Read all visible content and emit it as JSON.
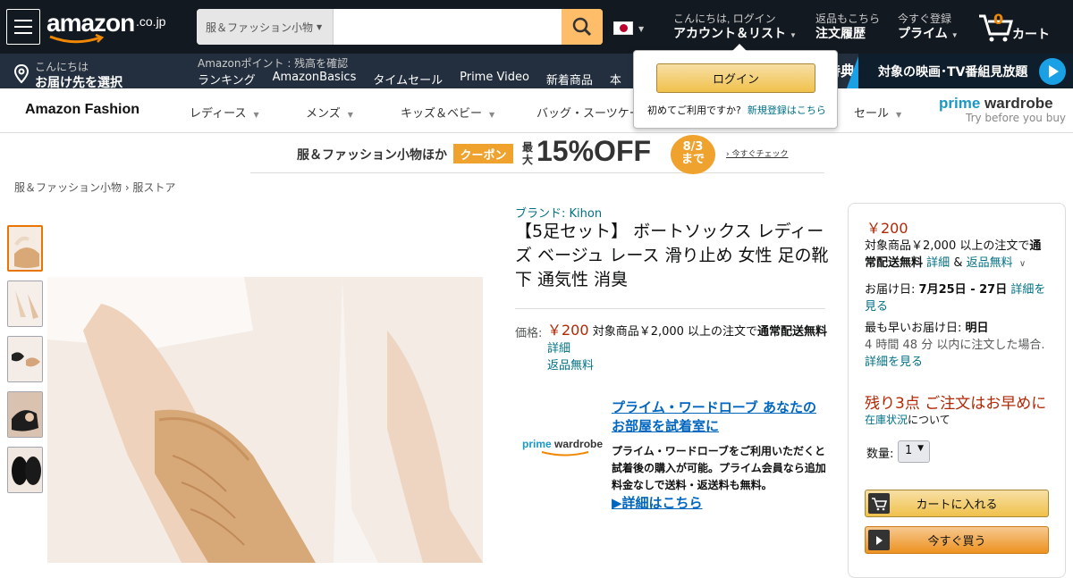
{
  "nav": {
    "logo_text": "amazon",
    "logo_suffix": ".co.jp",
    "search_category": "服＆ファッション小物",
    "search_value": "",
    "account_line1": "こんにちは, ログイン",
    "account_line2": "アカウント＆リスト",
    "orders_line1": "返品もこちら",
    "orders_line2": "注文履歴",
    "prime_line1": "今すぐ登録",
    "prime_line2": "プライム",
    "cart_count": "0",
    "cart_label": "カート"
  },
  "subnav": {
    "deliver_line1": "こんにちは",
    "deliver_line2": "お届け先を選択",
    "points": "Amazonポイント : 残高を確認",
    "links": [
      "ランキング",
      "AmazonBasics",
      "タイムセール",
      "Prime Video",
      "新着商品",
      "本"
    ],
    "promo_tag": "特典",
    "promo_text": "対象の映画･TV番組見放題"
  },
  "popover": {
    "login_label": "ログイン",
    "new_user_text": "初めてご利用ですか?",
    "new_user_link": "新規登録はこちら"
  },
  "fashion": {
    "logo": "Amazon Fashion",
    "nav": [
      "レディース",
      "メンズ",
      "キッズ＆ベビー",
      "バッグ・スーツケース",
      "セール"
    ],
    "prime_wardrobe_1": "prime",
    "prime_wardrobe_2": "wardrobe",
    "prime_wardrobe_tagline": "Try before you buy"
  },
  "coupon": {
    "text1": "服＆ファッション小物ほか",
    "badge": "クーポン",
    "prefix": "最大",
    "discount": "15%OFF",
    "date": "8/3",
    "until": "まで",
    "cta": "› 今すぐチェック"
  },
  "breadcrumb": "服＆ファッション小物 › 服ストア",
  "product": {
    "brand": "ブランド: Kihon",
    "title": "【5足セット】 ボートソックス レディーズ ベージュ レース 滑り止め 女性 足の靴下 通気性 消臭",
    "price_label": "価格:",
    "price": "￥200",
    "shipping_text": "対象商品￥2,000 以上の注文で",
    "shipping_bold": "通常配送無料",
    "details_link": "詳細",
    "returns_link": "返品無料"
  },
  "prime_wardrobe_box": {
    "logo1": "prime",
    "logo2": "wardrobe",
    "headline": "プライム・ワードローブ あなたのお部屋を試着室に",
    "body": "プライム・ワードローブをご利用いただくと試着後の購入が可能。プライム会員なら追加料金なしで送料・返送料も無料。",
    "more": "▶詳細はこちら"
  },
  "buybox": {
    "price": "￥200",
    "ship_text": "対象商品￥2,000 以上の注文で",
    "ship_bold": "通常配送無料",
    "ship_details": "詳細",
    "ship_and": "&",
    "ship_returns": "返品無料",
    "delivery_label": "お届け日:",
    "delivery_date": "7月25日 - 27日",
    "delivery_link": "詳細を見る",
    "fast_label": "最も早いお届け日:",
    "fast_date": "明日",
    "fast_note": "4 時間 48 分 以内に注文した場合.",
    "fast_link": "詳細を見る",
    "stock": "残り3点 ご注文はお早めに",
    "stock_link": "在庫状況",
    "stock_suffix": "について",
    "qty_label": "数量:",
    "qty_value": "1",
    "add_to_cart": "カートに入れる",
    "buy_now": "今すぐ買う"
  }
}
